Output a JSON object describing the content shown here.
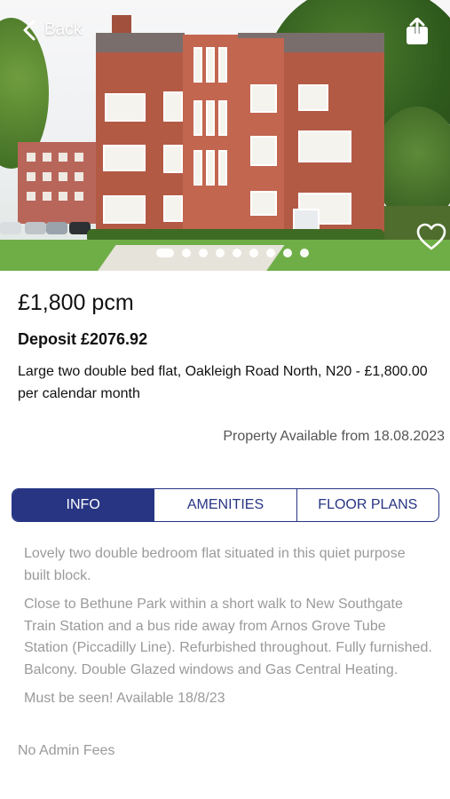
{
  "header": {
    "back_label": "Back",
    "share_icon": "share-icon",
    "favorite_icon": "heart-icon"
  },
  "gallery": {
    "total_images": 9,
    "active_index": 0
  },
  "listing": {
    "price": "£1,800 pcm",
    "deposit": "Deposit £2076.92",
    "title": "Large two double bed flat, Oakleigh Road North, N20 - £1,800.00 per calendar month",
    "available": "Property Available from 18.08.2023"
  },
  "tabs": [
    {
      "label": "INFO",
      "active": true
    },
    {
      "label": "AMENITIES",
      "active": false
    },
    {
      "label": "FLOOR PLANS",
      "active": false
    }
  ],
  "info": {
    "paragraphs": [
      "Lovely two double bedroom flat situated in this quiet purpose built block.",
      "Close to Bethune Park  within a short walk to New Southgate Train Station and a bus ride away from Arnos Grove Tube Station (Piccadilly Line). Refurbished throughout. Fully furnished. Balcony. Double Glazed windows and Gas Central Heating.",
      "Must be seen! Available 18/8/23"
    ],
    "fees": "No Admin Fees"
  },
  "colors": {
    "accent": "#273583",
    "muted_text": "#9a9a9a"
  }
}
